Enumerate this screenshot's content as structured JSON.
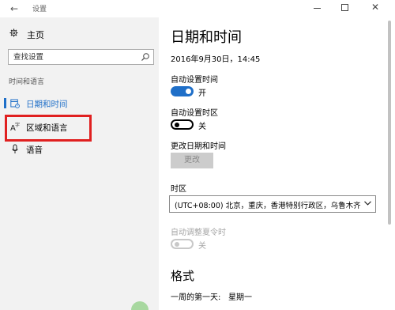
{
  "window": {
    "title": "设置"
  },
  "sidebar": {
    "home_label": "主页",
    "search_placeholder": "查找设置",
    "section_label": "时间和语言",
    "items": [
      {
        "label": "日期和时间",
        "icon": "calendar-clock-icon",
        "active": true
      },
      {
        "label": "区域和语言",
        "icon": "region-language-icon",
        "active": false,
        "highlighted": true
      },
      {
        "label": "语音",
        "icon": "microphone-icon",
        "active": false
      }
    ]
  },
  "main": {
    "title": "日期和时间",
    "datetime": "2016年9月30日，14:45",
    "auto_time": {
      "label": "自动设置时间",
      "state": "开",
      "on": true
    },
    "auto_timezone": {
      "label": "自动设置时区",
      "state": "关",
      "on": false
    },
    "change_datetime": {
      "label": "更改日期和时间",
      "button": "更改"
    },
    "timezone": {
      "label": "时区",
      "value": "(UTC+08:00) 北京，重庆，香港特别行政区，乌鲁木齐"
    },
    "dst": {
      "label": "自动调整夏令时",
      "state": "关",
      "on": false,
      "disabled": true
    },
    "format": {
      "heading": "格式",
      "first_day_label": "一周的第一天:",
      "first_day_value": "星期一"
    }
  },
  "colors": {
    "accent": "#1f6fc8",
    "highlight_box": "#e02020",
    "sidebar_bg": "#f2f2f2",
    "disabled": "#a6a6a6"
  }
}
